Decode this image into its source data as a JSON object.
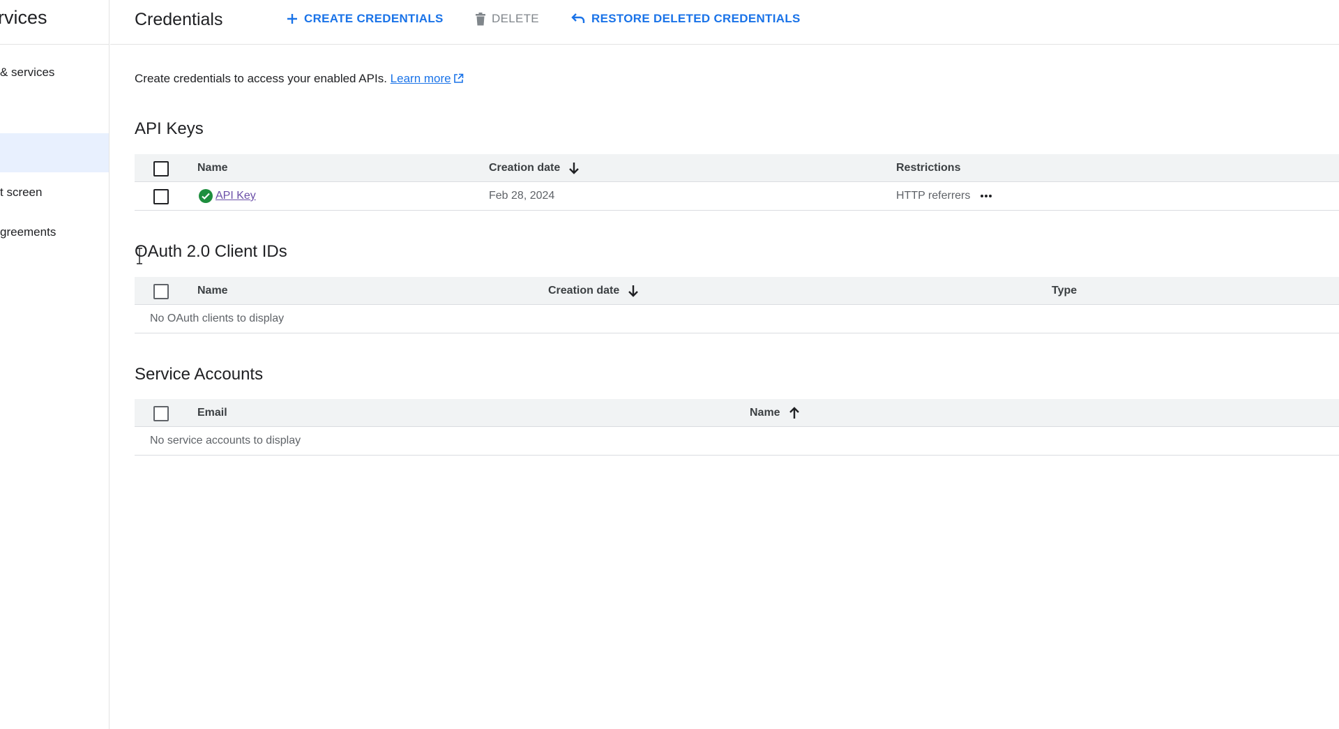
{
  "sidebar": {
    "title": "rvices",
    "items": [
      {
        "label": "& services",
        "active": false
      },
      {
        "label": "",
        "active": true
      },
      {
        "label": "t screen",
        "active": false
      },
      {
        "label": "greements",
        "active": false
      }
    ]
  },
  "header": {
    "title": "Credentials",
    "create_label": "CREATE CREDENTIALS",
    "delete_label": "DELETE",
    "restore_label": "RESTORE DELETED CREDENTIALS"
  },
  "intro": {
    "text": "Create credentials to access your enabled APIs.",
    "link": "Learn more"
  },
  "api_keys": {
    "title": "API Keys",
    "columns": {
      "name": "Name",
      "creation_date": "Creation date",
      "restrictions": "Restrictions"
    },
    "rows": [
      {
        "name": "API Key",
        "creation_date": "Feb 28, 2024",
        "restrictions": "HTTP referrers"
      }
    ]
  },
  "oauth": {
    "title": "OAuth 2.0 Client IDs",
    "columns": {
      "name": "Name",
      "creation_date": "Creation date",
      "type": "Type"
    },
    "empty": "No OAuth clients to display"
  },
  "service_accounts": {
    "title": "Service Accounts",
    "columns": {
      "email": "Email",
      "name": "Name"
    },
    "empty": "No service accounts to display"
  },
  "colors": {
    "accent": "#1a73e8",
    "success": "#1e8e3e",
    "header_bg": "#f1f3f4",
    "divider": "#dadce0"
  }
}
